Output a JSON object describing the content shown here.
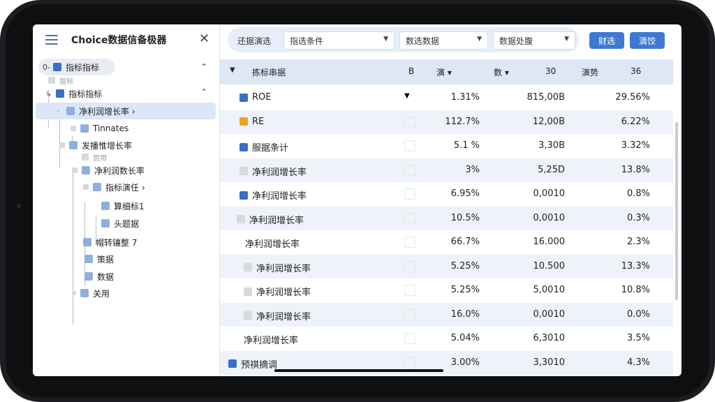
{
  "app": {
    "title": "Choice数据信备极器"
  },
  "tree": [
    {
      "label": "指标指标"
    },
    {
      "label": "指标"
    },
    {
      "label": "指标指标"
    },
    {
      "label": "净利润增长率 ›"
    },
    {
      "label": "Tinnates"
    },
    {
      "label": "发播惟增长率"
    },
    {
      "label": "宫用"
    },
    {
      "label": "净利润数长率"
    },
    {
      "label": "指标演任 ›"
    },
    {
      "label": "算细标1"
    },
    {
      "label": "头题据"
    },
    {
      "label": "帽转镶整 7"
    },
    {
      "label": "策据"
    },
    {
      "label": "数据"
    },
    {
      "label": "关用"
    }
  ],
  "filter": {
    "label": "还据演选",
    "select1": "指选条件",
    "select2": "数选数据",
    "select3": "数据处腹",
    "btn1": "财选",
    "btn2": "滴饺"
  },
  "table": {
    "headers": [
      "拣标串据",
      "B",
      "演 ▾",
      "数 ▾",
      "30",
      "演势",
      "36"
    ],
    "rows": [
      {
        "name": "ROE",
        "c1": "1.31%",
        "c2": "815,00B",
        "c3": "29.56%",
        "icon": "dark"
      },
      {
        "name": "RE",
        "c1": "112.7%",
        "c2": "12,00B",
        "c3": "6.22%",
        "icon": "orange"
      },
      {
        "name": "服据条计",
        "c1": "5.1 %",
        "c2": "3,30B",
        "c3": "3.32%",
        "icon": "dark"
      },
      {
        "name": "净利润增长率",
        "c1": "3%",
        "c2": "5,25D",
        "c3": "13.8%",
        "icon": "light"
      },
      {
        "name": "净利润增长率",
        "c1": "6.95%",
        "c2": "0,0010",
        "c3": "0.8%",
        "icon": "dark"
      },
      {
        "name": "净利润增长率",
        "c1": "10.5%",
        "c2": "0,0010",
        "c3": "0.3%",
        "icon": "light"
      },
      {
        "name": "净利润增长率",
        "c1": "66.7%",
        "c2": "16.000",
        "c3": "2.3%",
        "icon": "none"
      },
      {
        "name": "净利润增长率",
        "c1": "5.25%",
        "c2": "10.500",
        "c3": "13.3%",
        "icon": "light"
      },
      {
        "name": "净利润增长率",
        "c1": "5.25%",
        "c2": "5,0010",
        "c3": "10.8%",
        "icon": "light"
      },
      {
        "name": "净利润增长率",
        "c1": "16.0%",
        "c2": "0,0010",
        "c3": "0.0%",
        "icon": "light"
      },
      {
        "name": "净利润增长率",
        "c1": "5.04%",
        "c2": "6,3010",
        "c3": "3.5%",
        "icon": "none"
      },
      {
        "name": "预祺摘调",
        "c1": "3.00%",
        "c2": "3,3010",
        "c3": "4.3%",
        "icon": "dark"
      }
    ]
  },
  "colors": {
    "accent": "#3d79d4",
    "header_bg": "#dde7f6",
    "orange": "#f0a020"
  }
}
